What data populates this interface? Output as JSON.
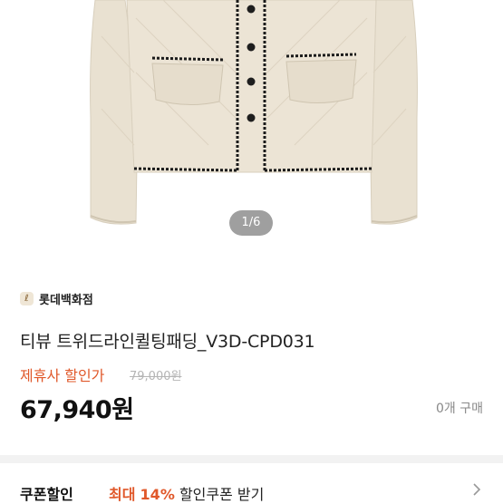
{
  "gallery": {
    "pager": "1/6"
  },
  "product": {
    "brand": "롯데백화점",
    "brand_logo_glyph": "ℓ",
    "title": "티뷰 트위드라인퀼팅패딩_V3D-CPD031",
    "partner_label": "제휴사 할인가",
    "original_price": "79,000원",
    "price": "67,940원",
    "purchase_count": "0개 구매"
  },
  "coupon": {
    "label": "쿠폰할인",
    "max_label": "최대",
    "rate": "14%",
    "action": "할인쿠폰 받기"
  },
  "colors": {
    "accent": "#e0582a",
    "jacket": "#ece4d5",
    "trim": "#1a1a1a"
  },
  "icons": {
    "chevron": "chevron-right-icon",
    "brand_logo": "lotte-logo-icon"
  }
}
